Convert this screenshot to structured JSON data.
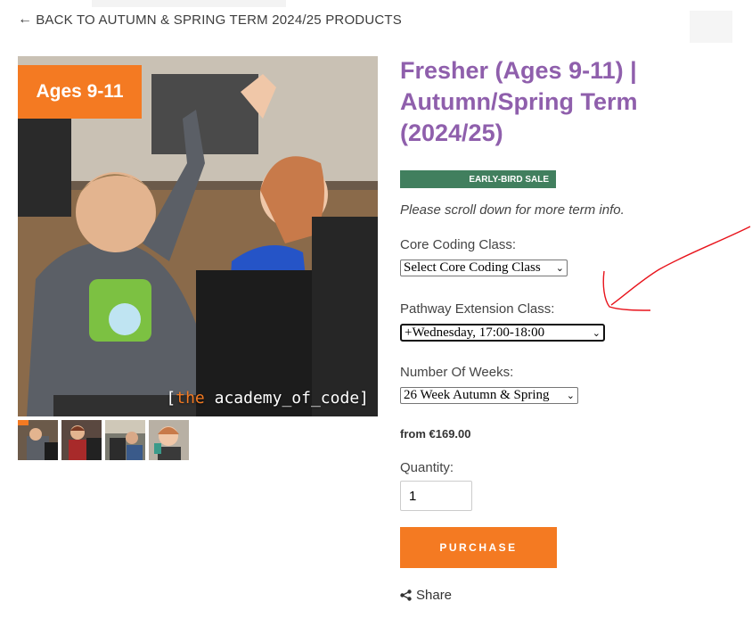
{
  "nav": {
    "back_arrow": "←",
    "back_label": "BACK TO AUTUMN & SPRING TERM 2024/25 PRODUCTS"
  },
  "product": {
    "image_badge": "Ages 9-11",
    "image_logo_prefix": "[",
    "image_logo_the": "the",
    "image_logo_rest": " academy_of_code]",
    "thumbnails": [
      "thumb-1",
      "thumb-2",
      "thumb-3",
      "thumb-4"
    ],
    "title": "Fresher (Ages 9-11) | Autumn/Spring Term (2024/25)",
    "sale_badge": "EARLY-BIRD SALE",
    "scroll_note": "Please scroll down for more term info.",
    "core_label": "Core Coding Class:",
    "core_value": "Select Core Coding Class",
    "pathway_label": "Pathway Extension Class:",
    "pathway_value": "+Wednesday, 17:00-18:00",
    "weeks_label": "Number Of Weeks:",
    "weeks_value": "26 Week Autumn & Spring",
    "price": "from €169.00",
    "quantity_label": "Quantity:",
    "quantity_value": "1",
    "purchase_label": "PURCHASE",
    "share_label": "Share"
  },
  "colors": {
    "title_purple": "#8f5fac",
    "accent_orange": "#f47a22",
    "sale_green": "#417f5e",
    "annotation_red": "#e8141c"
  },
  "icons": [
    "left-arrow-icon",
    "chevron-down-icon",
    "share-icon"
  ]
}
